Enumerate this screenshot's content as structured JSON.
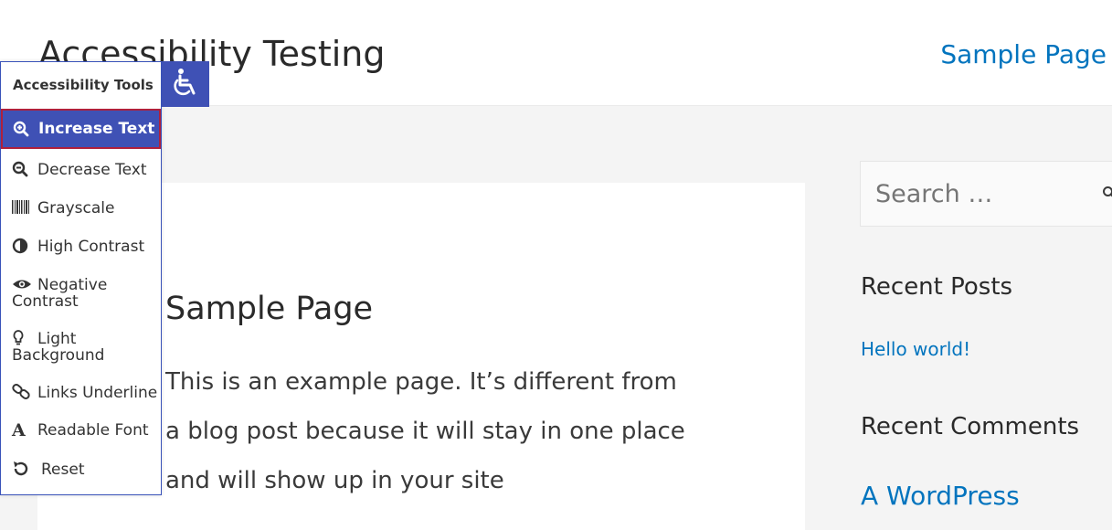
{
  "header": {
    "site_title": "Accessibility Testing",
    "nav_link": "Sample Page"
  },
  "main": {
    "page_title": "Sample Page",
    "body_text": "This is an example page. It’s different from a blog post because it will stay in one place and will show up in your site"
  },
  "sidebar": {
    "search_placeholder": "Search …",
    "recent_posts_title": "Recent Posts",
    "recent_posts": [
      "Hello world!"
    ],
    "recent_comments_title": "Recent Comments",
    "recent_comments": [
      "A WordPress"
    ]
  },
  "a11y_toolbar": {
    "heading": "Accessibility Tools",
    "accent_color": "#3f51b5",
    "items": [
      {
        "label": "Increase Text",
        "icon": "zoom-in-icon",
        "active": true
      },
      {
        "label": "Decrease Text",
        "icon": "zoom-out-icon"
      },
      {
        "label": "Grayscale",
        "icon": "barcode-icon"
      },
      {
        "label": "High Contrast",
        "icon": "contrast-icon"
      },
      {
        "label": "Negative Contrast",
        "icon": "eye-icon"
      },
      {
        "label": "Light Background",
        "icon": "lightbulb-icon"
      },
      {
        "label": "Links Underline",
        "icon": "link-icon"
      },
      {
        "label": "Readable Font",
        "icon": "font-icon"
      },
      {
        "label": "Reset",
        "icon": "reset-icon"
      }
    ]
  },
  "colors": {
    "link": "#0274be",
    "page_background": "#f4f4f4"
  }
}
